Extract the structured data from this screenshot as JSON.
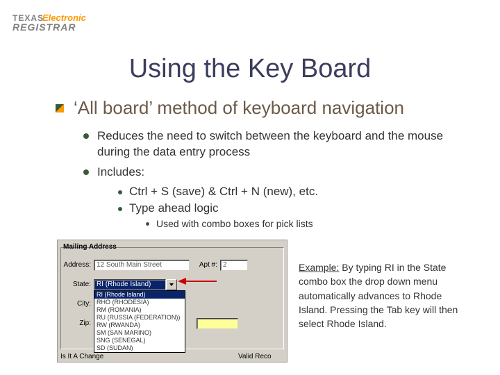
{
  "logo": {
    "texas": "TEXAS",
    "electronic": "Electronic",
    "registrar": "REGISTRAR"
  },
  "title": "Using the Key Board",
  "bullets": {
    "l1": "‘All board’ method of keyboard navigation",
    "l2a": "Reduces the need to switch between the keyboard and the mouse during the data entry process",
    "l2b": "Includes:",
    "l3a": "Ctrl + S (save) & Ctrl + N (new), etc.",
    "l3b": "Type ahead logic",
    "l4a": "Used with combo boxes for pick lists"
  },
  "example": {
    "label": "Example:",
    "text": "  By typing RI in the State combo box the drop down menu automatically advances to Rhode Island. Pressing the Tab key will then select Rhode Island."
  },
  "form": {
    "group": "Mailing Address",
    "labels": {
      "address": "Address:",
      "apt": "Apt #:",
      "state": "State:",
      "city": "City:",
      "zip": "Zip:"
    },
    "values": {
      "address": "12 South Main Street",
      "apt": "2",
      "state": "RI (Rhode Island)"
    },
    "dropdown": [
      "RI (Rhode Island)",
      "RHO (RHODESIA)",
      "RM (ROMANIA)",
      "RU (RUSSIA (FEDERATION))",
      "RW (RWANDA)",
      "SM (SAN MARINO)",
      "SNG (SENEGAL)",
      "SD (SUDAN)"
    ],
    "footer_left": "Is It A Change",
    "footer_right": "Valid Reco"
  }
}
